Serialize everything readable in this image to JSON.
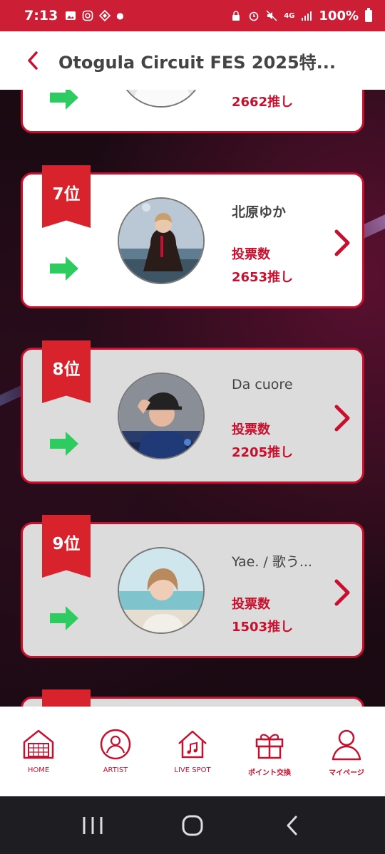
{
  "status_bar": {
    "time": "7:13",
    "battery": "100%",
    "network": "4G"
  },
  "header": {
    "title": "Otogula Circuit FES 2025特..."
  },
  "ranking": {
    "partial_card": {
      "vote_count": "2662推し"
    },
    "cards": [
      {
        "rank": "7位",
        "name": "北原ゆか",
        "vote_label": "投票数",
        "vote_count": "2653推し",
        "style": "white"
      },
      {
        "rank": "8位",
        "name": "Da cuore",
        "vote_label": "投票数",
        "vote_count": "2205推し",
        "style": "grey"
      },
      {
        "rank": "9位",
        "name": "Yae. / 歌う...",
        "vote_label": "投票数",
        "vote_count": "1503推し",
        "style": "grey"
      }
    ]
  },
  "bottom_nav": {
    "items": [
      {
        "label": "HOME",
        "icon": "home-icon"
      },
      {
        "label": "ARTIST",
        "icon": "artist-icon"
      },
      {
        "label": "LIVE SPOT",
        "icon": "live-spot-icon"
      },
      {
        "label": "ポイント交換",
        "icon": "gift-icon"
      },
      {
        "label": "マイページ",
        "icon": "mypage-icon"
      }
    ]
  },
  "colors": {
    "brand": "#c8102e",
    "badge": "#d8222c",
    "trend_up": "#2ecc60"
  }
}
